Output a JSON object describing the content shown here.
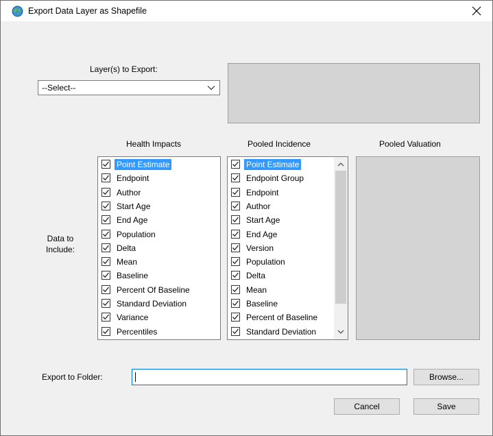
{
  "window": {
    "title": "Export Data Layer as Shapefile",
    "close_label": "✕"
  },
  "layers": {
    "label": "Layer(s) to Export:",
    "selected": "--Select--"
  },
  "data_label": "Data to\nInclude:",
  "health_impacts": {
    "header": "Health Impacts",
    "items": [
      "Point Estimate",
      "Endpoint",
      "Author",
      "Start Age",
      "End Age",
      "Population",
      "Delta",
      "Mean",
      "Baseline",
      "Percent Of Baseline",
      "Standard Deviation",
      "Variance",
      "Percentiles"
    ]
  },
  "pooled_incidence": {
    "header": "Pooled Incidence",
    "items": [
      "Point Estimate",
      "Endpoint Group",
      "Endpoint",
      "Author",
      "Start Age",
      "End Age",
      "Version",
      "Population",
      "Delta",
      "Mean",
      "Baseline",
      "Percent of Baseline",
      "Standard Deviation"
    ]
  },
  "pooled_valuation": {
    "header": "Pooled Valuation"
  },
  "export_folder": {
    "label": "Export to Folder:",
    "value": ""
  },
  "buttons": {
    "browse": "Browse...",
    "cancel": "Cancel",
    "save": "Save"
  },
  "colors": {
    "selection": "#3399ff",
    "input_focus": "#0078d7"
  },
  "icons": {
    "app": "globe-icon",
    "close": "close-icon",
    "dropdown": "chevron-down-icon",
    "check": "checkmark-icon",
    "scroll_up": "scroll-up-icon",
    "scroll_down": "scroll-down-icon"
  }
}
